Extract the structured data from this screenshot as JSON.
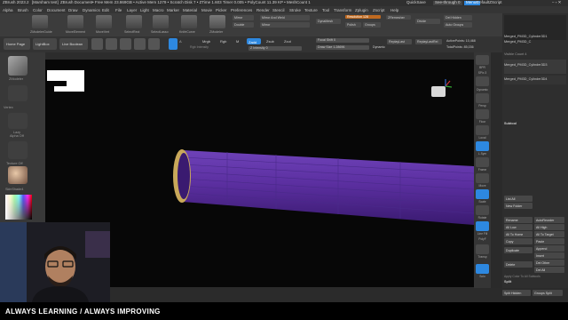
{
  "title_bar": {
    "app": "ZBrush 2023.2",
    "document": "[Marsham test]",
    "doc_label": "ZBrush Document",
    "stats": "• Free Mem 23.869GB • Active Mem 1279 • Scratch Disk 7 • ZTime 1.603 Timer 0.005 • PolyCount 11.39 KP • MeshCount 1",
    "quicksave": "QuickSave",
    "see_through": "See-through 0",
    "menus_btn": "Menus",
    "script": "DefaultZScript"
  },
  "menu_bar": [
    "Alpha",
    "Brush",
    "Color",
    "Document",
    "Draw",
    "Dynamics",
    "Edit",
    "File",
    "Layer",
    "Light",
    "Macro",
    "Marker",
    "Material",
    "Movie",
    "Picker",
    "Preferences",
    "Render",
    "Stencil",
    "Stroke",
    "Texture",
    "Tool",
    "Transform",
    "Zplugin",
    "Zscript",
    "Help"
  ],
  "shelf": {
    "items": [
      {
        "label": "ZModelerGuide"
      },
      {
        "label": "MoveElement"
      },
      {
        "label": "MoveVert"
      },
      {
        "label": "SelectRect"
      },
      {
        "label": "SelectLasso"
      },
      {
        "label": "KnifeCurve"
      },
      {
        "label": "ZModeler"
      }
    ],
    "mirror": "Mirror",
    "mirror_and_weld": "Mirror And Weld",
    "double": "Double",
    "dynamesh": "DynaMesh",
    "resolution": "Resolution 128",
    "polish": "Polish",
    "groups": "Groups",
    "zremesher": "ZRemesher",
    "divide": "Divide",
    "del_hidden": "Del Hidden",
    "auto_groups": "Auto Groups"
  },
  "toolbar2": {
    "home_page": "Home Page",
    "lightbox": "LightBox",
    "live_boolean": "Live Boolean",
    "edit": "Edit",
    "draw": "Draw",
    "move": "Move",
    "scale": "Scale",
    "rotate": "Rotate",
    "a_label": "A",
    "mrgb": "Mrgb",
    "rgb": "Rgb",
    "m": "M",
    "rgb_intensity": "Rgb Intensity",
    "zadd": "Zadd",
    "zsub": "Zsub",
    "zcut": "Zcut",
    "z_intensity": "Z Intensity 0",
    "focal_shift": "Focal Shift 0",
    "draw_size": "Draw Size 1.28696",
    "dynamic": "Dynamic",
    "replay_last": "ReplayLast",
    "replay_last_rel": "ReplayLastRel",
    "active_points": "ActivePoints: 10,468",
    "total_points": "TotalPoints: 85,036"
  },
  "left_panel": {
    "zmodeler": "ZModeler",
    "vertex_label": "Vertex",
    "lazy": "Lazy",
    "alpha_off": "Alpha Off",
    "texture_off": "Texture Off",
    "material": "SkinShade4",
    "gradient": "Gradient",
    "switch_color": "SwitchColor"
  },
  "right_strip": [
    "BPR",
    "SPix 3",
    "Dynamic",
    "Persp",
    "Floor",
    "Local",
    "L.Sym",
    "Frame",
    "Move",
    "Scale",
    "Rotate",
    "Line Fill",
    "PolyF",
    "Transp",
    "Solo"
  ],
  "right_panel": {
    "subtool_names": [
      "Merged_PM3D_Cylinder3D1",
      "Merged_PM3D_C",
      "Merged_PM3D_Cylinder3D3",
      "Merged_PM3D_Cylinder3D4"
    ],
    "visible_count": "Visible Count 4",
    "subtool_header": "Subtool",
    "list_all": "List All",
    "new_folder": "New Folder",
    "rename": "Rename",
    "auto_reorder": "AutoReorder",
    "all_low": "All Low",
    "all_high": "All High",
    "all_to_home": "All To Home",
    "all_to_target": "All To Target",
    "copy": "Copy",
    "paste": "Paste",
    "duplicate": "Duplicate",
    "append": "Append",
    "insert": "Insert",
    "del_other": "Del Other",
    "delete": "Delete",
    "del_all": "Del All",
    "apply_folder": "Apply Color To All Subtools",
    "split": "Split",
    "split_hidden": "Split Hidden",
    "groups_split": "Groups Split"
  },
  "banner": {
    "text": "ALWAYS LEARNING  /  ALWAYS IMPROVING"
  },
  "colors": {
    "accent_blue": "#2d88e0",
    "accent_orange": "#c06a20",
    "mesh_purple": "#5b2fa0",
    "rim_gold": "#c9a85a"
  }
}
